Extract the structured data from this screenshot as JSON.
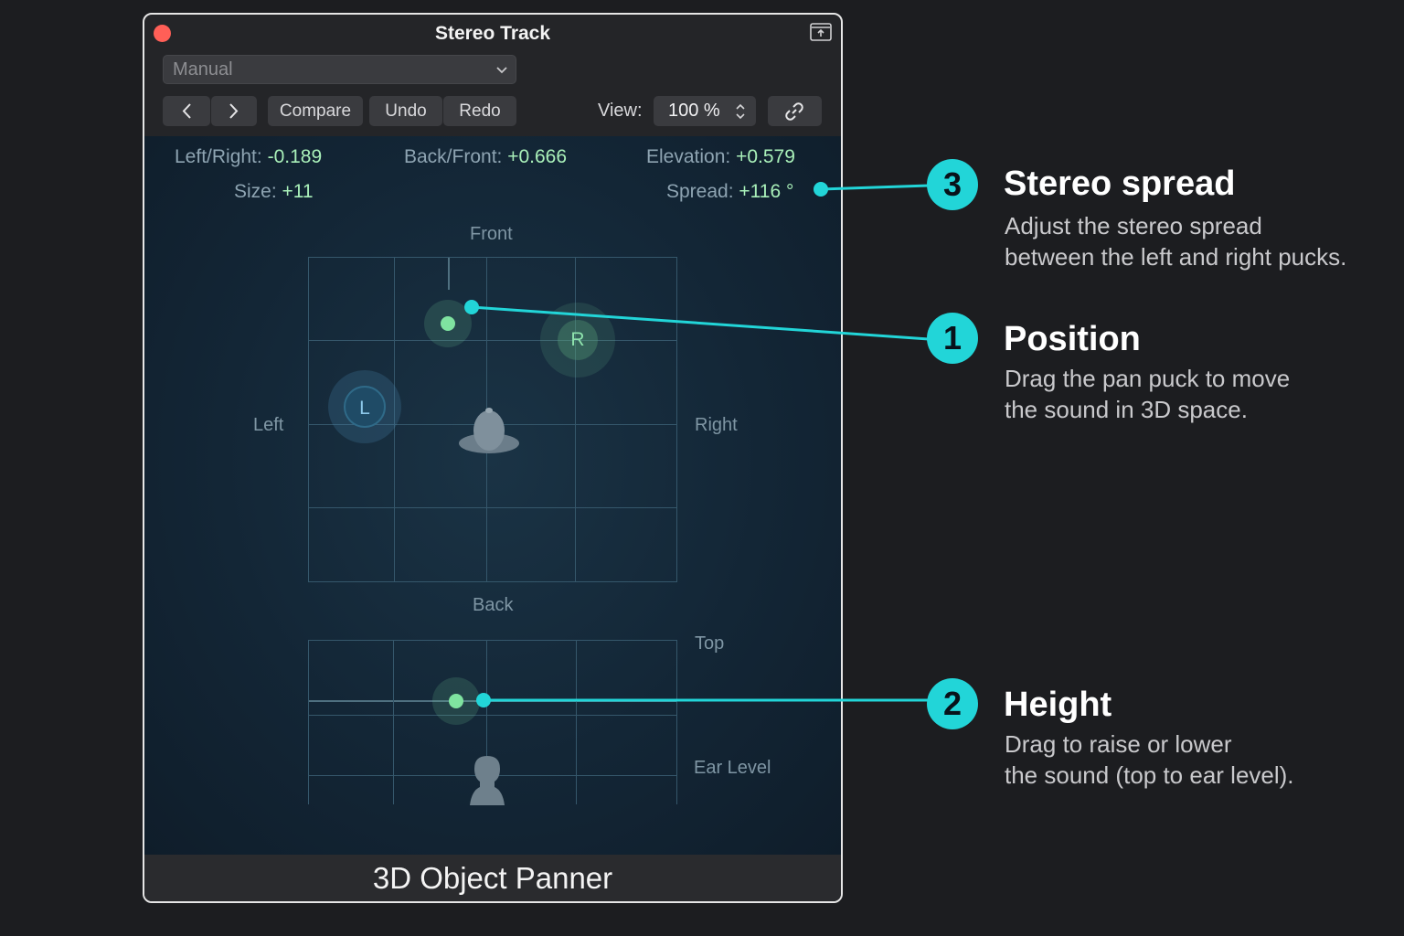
{
  "window": {
    "title": "Stereo Track",
    "preset": "Manual",
    "nav": {
      "prev": "‹",
      "next": "›"
    },
    "toolbar": {
      "compare": "Compare",
      "undo": "Undo",
      "redo": "Redo"
    },
    "view_label": "View:",
    "view_value": "100 %",
    "footer_title": "3D Object Panner"
  },
  "params": {
    "left_right": {
      "label": "Left/Right:",
      "value": "-0.189"
    },
    "back_front": {
      "label": "Back/Front:",
      "value": "+0.666"
    },
    "elevation": {
      "label": "Elevation:",
      "value": "+0.579"
    },
    "size": {
      "label": "Size:",
      "value": "+11"
    },
    "spread": {
      "label": "Spread:",
      "value": "+116 °"
    }
  },
  "panner": {
    "front": "Front",
    "back": "Back",
    "left": "Left",
    "right": "Right",
    "top": "Top",
    "ear_level": "Ear Level",
    "left_puck": "L",
    "right_puck": "R"
  },
  "callouts": [
    {
      "number": "3",
      "title": "Stereo spread",
      "description": "Adjust the stereo spread\nbetween the left and right pucks."
    },
    {
      "number": "1",
      "title": "Position",
      "description": "Drag the pan puck to move\nthe sound in 3D space."
    },
    {
      "number": "2",
      "title": "Height",
      "description": "Drag to raise or lower\nthe sound (top to ear level)."
    }
  ],
  "colors": {
    "accent": "#22d5d8",
    "puck": "#7fe3a0",
    "value_green": "#a9f0b9",
    "close": "#ff5f57",
    "panel_bg": "#132636"
  }
}
